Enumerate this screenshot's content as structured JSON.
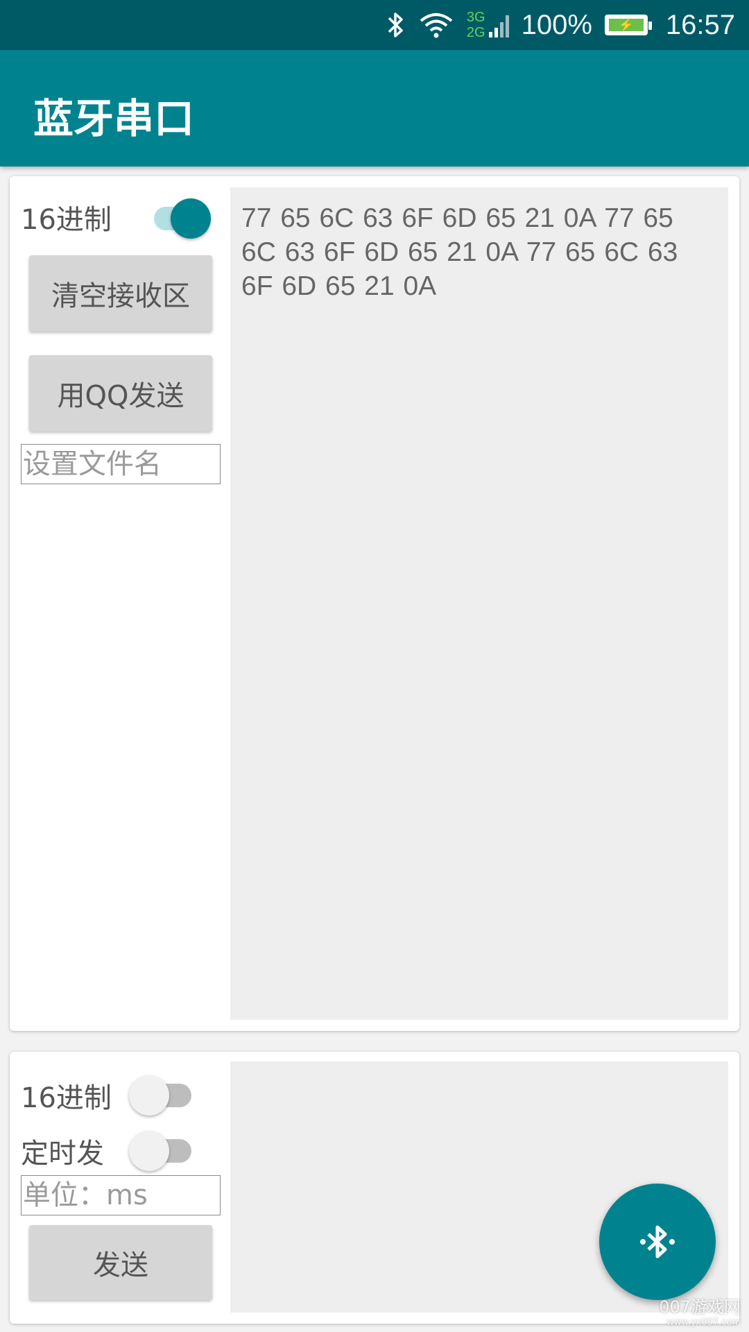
{
  "status_bar": {
    "net_top": "3G",
    "net_bottom": "2G",
    "battery_percent": "100%",
    "time": "16:57"
  },
  "app_bar": {
    "title": "蓝牙串口"
  },
  "receive": {
    "hex_label": "16进制",
    "hex_enabled": true,
    "clear_button": "清空接收区",
    "qq_send_button": "用QQ发送",
    "filename_placeholder": "设置文件名",
    "received_text": "77 65 6C 63 6F 6D 65 21 0A 77 65 6C 63 6F 6D 65 21 0A 77 65 6C 63 6F 6D 65 21 0A"
  },
  "send": {
    "hex_label": "16进制",
    "hex_enabled": false,
    "timer_label": "定时发",
    "timer_enabled": false,
    "interval_placeholder": "单位：ms",
    "send_button": "发送",
    "send_text": ""
  },
  "watermark": {
    "main": "007游戏网",
    "sub": "www.yx007.com"
  },
  "colors": {
    "primary": "#00838f",
    "primary_dark": "#005a66",
    "switch_on_track": "#b2dfe3"
  }
}
